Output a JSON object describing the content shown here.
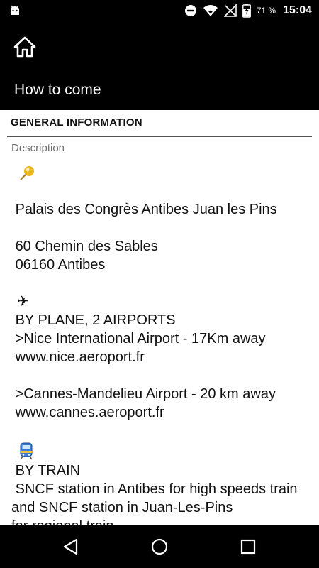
{
  "status_bar": {
    "battery": "71 %",
    "time": "15:04"
  },
  "app_bar": {
    "title": "How to come"
  },
  "section": {
    "header": "GENERAL INFORMATION",
    "label": "Description"
  },
  "description": {
    "venue_line1": " Palais des Congrès Antibes Juan les Pins",
    "venue_line2": " 60 Chemin des Sables",
    "venue_line3": " 06160 Antibes",
    "plane_icon": "✈",
    "plane_line1": " BY PLANE, 2 AIRPORTS",
    "plane_line2": " >Nice International Airport - 17Km away",
    "plane_line3": " www.nice.aeroport.fr",
    "plane_line4": " >Cannes-Mandelieu Airport - 20 km away",
    "plane_line5": " www.cannes.aeroport.fr",
    "train_line1": " BY TRAIN",
    "train_line2": " SNCF station in Antibes for high speeds train and SNCF station in Juan-Les-Pins",
    "train_line3": "for regional train"
  },
  "icons": {
    "android": "android-icon",
    "dnd": "do-not-disturb-icon",
    "wifi": "wifi-icon",
    "signal": "no-signal-icon",
    "battery": "battery-charging-icon",
    "home": "home-icon",
    "pin": "round-pushpin-icon",
    "plane": "airplane-icon",
    "train": "train-icon",
    "back": "back-icon",
    "nav_home": "nav-home-icon",
    "recents": "recents-icon"
  }
}
